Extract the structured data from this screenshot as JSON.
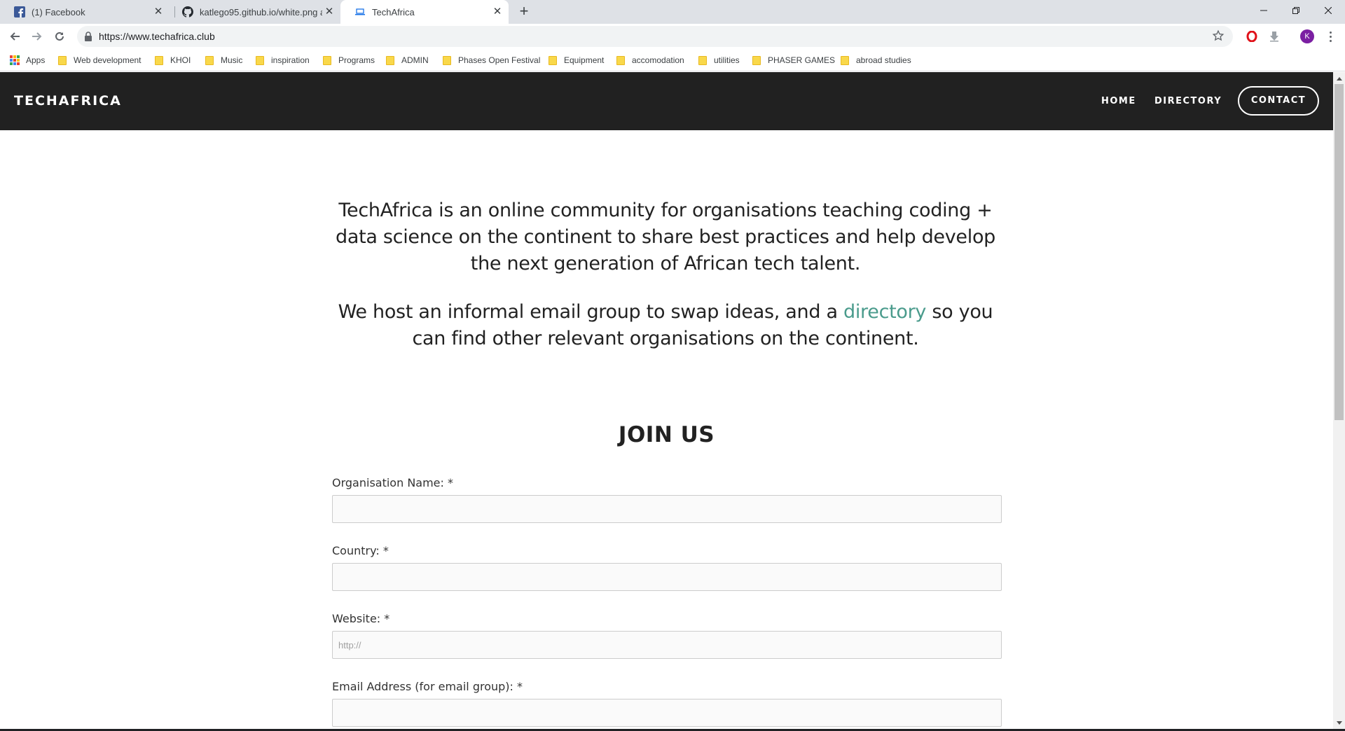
{
  "browser": {
    "tabs": [
      {
        "title": "(1) Facebook",
        "icon": "facebook-icon"
      },
      {
        "title": "katlego95.github.io/white.png at",
        "icon": "github-icon"
      },
      {
        "title": "TechAfrica",
        "icon": "laptop-icon"
      }
    ],
    "url": "https://www.techafrica.club",
    "bookmarks": [
      "Apps",
      "Web development",
      "KHOI",
      "Music",
      "inspiration",
      "Programs",
      "ADMIN",
      "Phases Open Festival",
      "Equipment",
      "accomodation",
      "utilities",
      "PHASER GAMES",
      "abroad studies"
    ],
    "profile_initial": "K"
  },
  "site": {
    "logo": "TECHAFRICA",
    "nav": {
      "home": "HOME",
      "directory": "DIRECTORY",
      "contact": "CONTACT"
    },
    "intro_p1": "TechAfrica is an online community for organisations teaching coding + data science on the continent to share best practices and help develop the next generation of African tech talent.",
    "intro_p2_before": "We host an informal email group to swap ideas, and a ",
    "intro_p2_link": "directory",
    "intro_p2_after": " so you can find other relevant organisations on the continent.",
    "join_title": "JOIN US",
    "form": {
      "org_label": "Organisation Name: *",
      "country_label": "Country: *",
      "website_label": "Website: *",
      "website_placeholder": "http://",
      "email_label": "Email Address (for email group): *"
    }
  },
  "colors": {
    "header_bg": "#212121",
    "link_accent": "#4a9b8c",
    "tab_bar": "#dee1e6"
  }
}
